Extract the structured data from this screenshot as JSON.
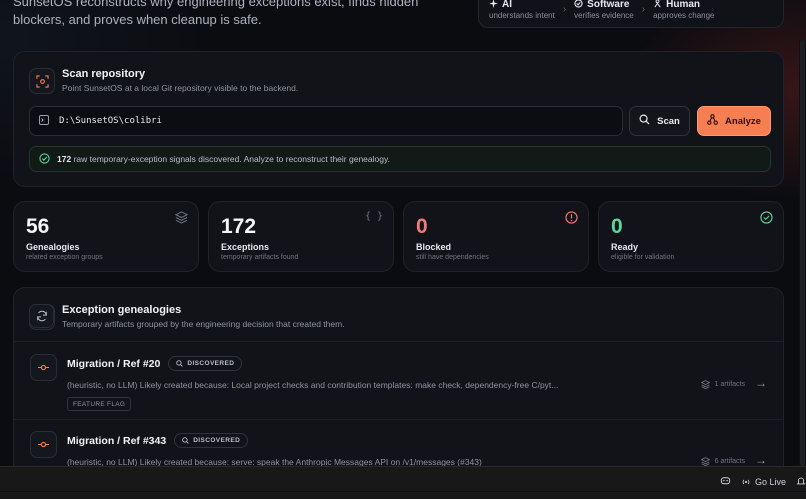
{
  "intro": {
    "text": "SunsetOS reconstructs why engineering exceptions exist, finds hidden blockers, and proves when cleanup is safe."
  },
  "flow": [
    {
      "title": "AI",
      "sub": "understands intent",
      "icon": "sparkle-icon"
    },
    {
      "title": "Software",
      "sub": "verifies evidence",
      "icon": "check-circle-icon"
    },
    {
      "title": "Human",
      "sub": "approves change",
      "icon": "human-icon"
    }
  ],
  "scan": {
    "title": "Scan repository",
    "subtitle": "Point SunsetOS at a local Git repository visible to the backend.",
    "path": "D:\\SunsetOS\\colibri",
    "scan_label": "Scan",
    "analyze_label": "Analyze",
    "notice_count": "172",
    "notice_text": "raw temporary-exception signals discovered. Analyze to reconstruct their genealogy."
  },
  "stats": [
    {
      "value": "56",
      "label": "Genealogies",
      "sub": "related exception groups",
      "color": "#f4f5f7",
      "icon": "layers-icon"
    },
    {
      "value": "172",
      "label": "Exceptions",
      "sub": "temporary artifacts found",
      "color": "#f4f5f7",
      "icon": "braces-icon"
    },
    {
      "value": "0",
      "label": "Blocked",
      "sub": "still have dependencies",
      "color": "#f07a7a",
      "icon": "alert-icon"
    },
    {
      "value": "0",
      "label": "Ready",
      "sub": "eligible for validation",
      "color": "#5fd49a",
      "icon": "check-icon"
    }
  ],
  "genealogies": {
    "title": "Exception genealogies",
    "subtitle": "Temporary artifacts grouped by the engineering decision that created them.",
    "items": [
      {
        "name": "Migration / Ref #20",
        "badge": "DISCOVERED",
        "desc": "(heuristic, no LLM) Likely created because: Local project checks and contribution templates: make check, dependency-free C/pyt...",
        "tag": "FEATURE FLAG",
        "meta": "1 artifacts"
      },
      {
        "name": "Migration / Ref #343",
        "badge": "DISCOVERED",
        "desc": "(heuristic, no LLM) Likely created because: serve: speak the Anthropic Messages API on /v1/messages (#343)",
        "tag": "",
        "meta": "6 artifacts"
      }
    ]
  },
  "statusbar": {
    "go_live": "Go Live"
  },
  "colors": {
    "accent": "#f57f52",
    "ready": "#5fd49a",
    "blocked": "#f07a7a"
  }
}
